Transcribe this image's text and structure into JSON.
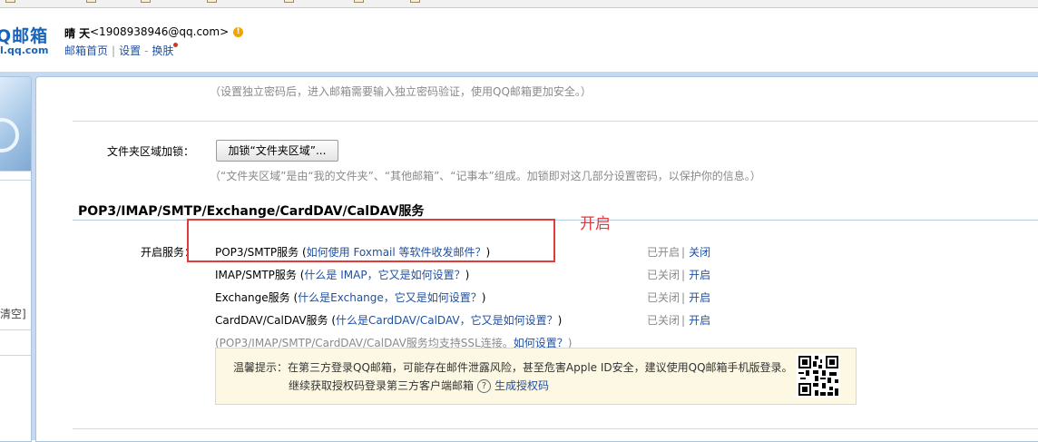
{
  "header": {
    "logo_text": "Q邮箱",
    "logo_domain": "l.qq.com",
    "user_name": "晴 天",
    "user_email": "<1908938946@qq.com>",
    "warn_symbol": "!",
    "links": [
      "邮箱首页",
      "设置",
      "换肤"
    ]
  },
  "sidebar": {
    "clear_text": "清空]"
  },
  "settings": {
    "password_note": "（设置独立密码后，进入邮箱需要输入独立密码验证，使用QQ邮箱更加安全。）",
    "folder_lock_label": "文件夹区域加锁：",
    "folder_lock_button": "加锁“文件夹区域”...",
    "folder_lock_note": "（“文件夹区域”是由“我的文件夹”、“其他邮箱”、“记事本”组成。加锁即对这几部分设置密码，以保护你的信息。）"
  },
  "section": {
    "title": "POP3/IMAP/SMTP/Exchange/CardDAV/CalDAV服务",
    "enable_label": "开启服务：",
    "annotation_label": "开启",
    "services": [
      {
        "name": "POP3/SMTP服务",
        "help": "如何使用 Foxmail 等软件收发邮件？",
        "status": "已开启",
        "action": "关闭"
      },
      {
        "name": "IMAP/SMTP服务",
        "help": "什么是 IMAP，它又是如何设置？",
        "status": "已关闭",
        "action": "开启"
      },
      {
        "name": "Exchange服务",
        "help": "什么是Exchange，它又是如何设置？",
        "status": "已关闭",
        "action": "开启"
      },
      {
        "name": "CardDAV/CalDAV服务",
        "help": "什么是CardDAV/CalDAV，它又是如何设置？",
        "status": "已关闭",
        "action": "开启"
      }
    ],
    "ssl_note": "(POP3/IMAP/SMTP/CardDAV/CalDAV服务均支持SSL连接。",
    "ssl_link": "如何设置？",
    "ssl_note_end": ")"
  },
  "tip": {
    "line1": "温馨提示：在第三方登录QQ邮箱，可能存在邮件泄露风险，甚至危害Apple ID安全，建议使用QQ邮箱手机版登录。",
    "line2": "继续获取授权码登录第三方客户端邮箱",
    "question_symbol": "?",
    "generate_link": "生成授权码"
  },
  "colors": {
    "link": "#1e50a2",
    "annotation": "#e23b3b",
    "band": "#c5daf0"
  }
}
